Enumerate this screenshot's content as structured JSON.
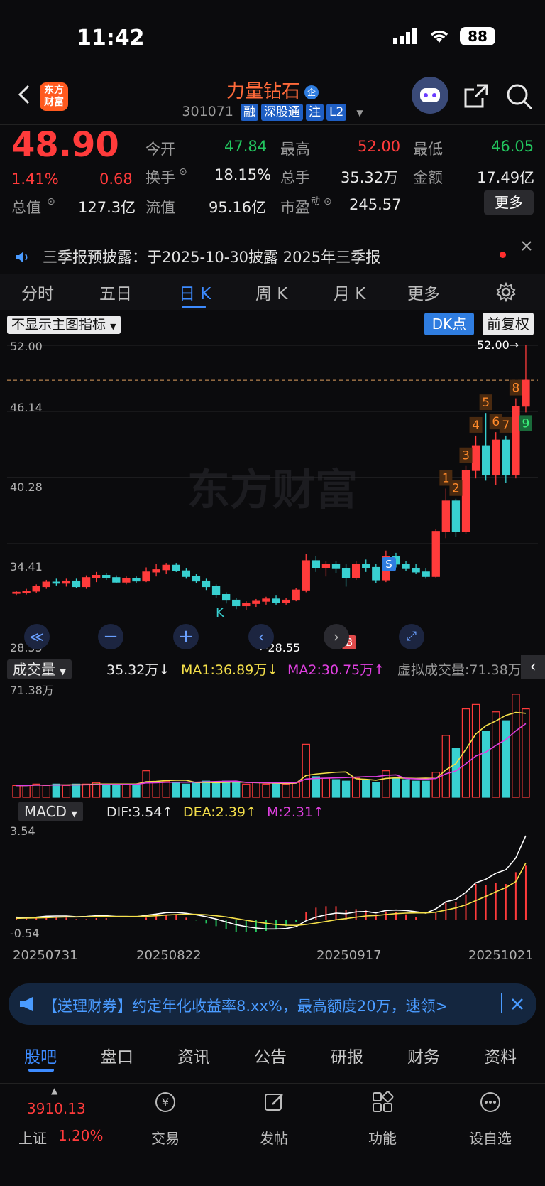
{
  "status_bar": {
    "time": "11:42",
    "battery": "88"
  },
  "header": {
    "logo_line1": "东方",
    "logo_line2": "财富",
    "stock_name": "力量钻石",
    "stock_badge": "企",
    "stock_code": "301071",
    "tags": [
      "融",
      "深股通",
      "注",
      "L2"
    ]
  },
  "quote": {
    "price": "48.90",
    "change_pct": "1.41%",
    "change": "0.68",
    "open_label": "今开",
    "open": "47.84",
    "high_label": "最高",
    "high": "52.00",
    "low_label": "最低",
    "low": "46.05",
    "turnover_label": "换手",
    "turnover": "18.15%",
    "volume_label": "总手",
    "volume": "35.32万",
    "amount_label": "金额",
    "amount": "17.49亿",
    "mcap_label": "总值",
    "mcap": "127.3亿",
    "float_label": "流值",
    "float_cap": "95.16亿",
    "pe_label": "市盈",
    "pe_super": "动",
    "pe": "245.57",
    "more_label": "更多"
  },
  "notice": {
    "text": "三季报预披露：于2025-10-30披露 2025年三季报"
  },
  "tabs": [
    {
      "label": "分时"
    },
    {
      "label": "五日"
    },
    {
      "label": "日 K"
    },
    {
      "label": "周 K"
    },
    {
      "label": "月 K"
    },
    {
      "label": "更多"
    }
  ],
  "chart_controls": {
    "indicator_dropdown": "不显示主图指标",
    "dk_label": "DK点",
    "fq_label": "前复权"
  },
  "price_axis": [
    "52.00",
    "46.14",
    "40.28",
    "34.41",
    "28.55"
  ],
  "chart_labels": {
    "high_marker": "52.00→",
    "low_marker": "←28.55",
    "k_marker": "K",
    "s_marker": "S",
    "b_marker": "B",
    "watermark": "东方财富",
    "nine_turn": [
      "1",
      "2",
      "3",
      "4",
      "5",
      "6",
      "7",
      "8",
      "9"
    ]
  },
  "volume_panel": {
    "dropdown": "成交量",
    "vol": "35.32万↓",
    "ma1": "MA1:36.89万↓",
    "ma2": "MA2:30.75万↑",
    "virtual": "虚拟成交量:71.38万",
    "max_label": "71.38万"
  },
  "macd_panel": {
    "dropdown": "MACD",
    "dif": "DIF:3.54↑",
    "dea": "DEA:2.39↑",
    "m": "M:2.31↑",
    "top_label": "3.54",
    "bottom_label": "-0.54"
  },
  "dates": [
    "20250731",
    "20250822",
    "20250917",
    "20251021"
  ],
  "banner": {
    "text": "【送理财券】约定年化收益率8.xx%，最高额度20万，速领>"
  },
  "bottom_tabs": [
    {
      "label": "股吧"
    },
    {
      "label": "盘口"
    },
    {
      "label": "资讯"
    },
    {
      "label": "公告"
    },
    {
      "label": "研报"
    },
    {
      "label": "财务"
    },
    {
      "label": "资料"
    }
  ],
  "bottom_nav": {
    "index_value": "3910.13",
    "index_name": "上证",
    "index_change": "1.20%",
    "items": [
      {
        "label": "交易"
      },
      {
        "label": "发帖"
      },
      {
        "label": "功能"
      },
      {
        "label": "设自选"
      }
    ]
  },
  "chart_data": {
    "type": "candlestick",
    "price_range": [
      28.55,
      52.0
    ],
    "candles": [
      [
        30.0,
        30.2,
        29.8,
        30.1
      ],
      [
        30.1,
        30.4,
        29.9,
        30.2
      ],
      [
        30.2,
        30.8,
        30.0,
        30.6
      ],
      [
        30.6,
        31.2,
        30.4,
        31.0
      ],
      [
        31.0,
        31.3,
        30.7,
        30.9
      ],
      [
        30.9,
        31.3,
        30.6,
        31.1
      ],
      [
        31.1,
        31.3,
        30.5,
        30.6
      ],
      [
        30.6,
        31.6,
        30.4,
        31.4
      ],
      [
        31.4,
        31.9,
        31.0,
        31.6
      ],
      [
        31.6,
        31.8,
        31.2,
        31.4
      ],
      [
        31.4,
        31.6,
        30.9,
        31.0
      ],
      [
        31.0,
        31.5,
        30.8,
        31.3
      ],
      [
        31.3,
        31.5,
        30.9,
        31.1
      ],
      [
        31.1,
        32.3,
        31.0,
        31.9
      ],
      [
        31.9,
        32.6,
        31.5,
        32.1
      ],
      [
        32.1,
        32.7,
        31.7,
        32.5
      ],
      [
        32.5,
        32.7,
        31.9,
        32.0
      ],
      [
        32.0,
        32.2,
        31.3,
        31.5
      ],
      [
        31.5,
        31.7,
        30.9,
        31.1
      ],
      [
        31.1,
        31.3,
        30.3,
        30.6
      ],
      [
        30.6,
        30.8,
        29.6,
        29.9
      ],
      [
        29.9,
        30.1,
        29.1,
        29.4
      ],
      [
        29.4,
        29.6,
        28.6,
        28.9
      ],
      [
        28.9,
        29.3,
        28.55,
        29.1
      ],
      [
        29.1,
        29.5,
        28.8,
        29.3
      ],
      [
        29.3,
        29.7,
        29.0,
        29.5
      ],
      [
        29.5,
        29.8,
        29.0,
        29.2
      ],
      [
        29.2,
        29.6,
        29.0,
        29.4
      ],
      [
        29.4,
        30.5,
        29.3,
        30.3
      ],
      [
        30.3,
        33.5,
        30.1,
        32.9
      ],
      [
        32.9,
        33.3,
        31.9,
        32.3
      ],
      [
        32.3,
        32.9,
        31.5,
        32.6
      ],
      [
        32.6,
        32.9,
        31.8,
        32.2
      ],
      [
        32.2,
        32.6,
        30.6,
        31.4
      ],
      [
        31.4,
        32.9,
        31.2,
        32.6
      ],
      [
        32.6,
        33.0,
        31.9,
        32.3
      ],
      [
        32.3,
        32.6,
        30.9,
        31.2
      ],
      [
        31.2,
        33.8,
        31.0,
        33.3
      ],
      [
        33.3,
        33.6,
        32.3,
        32.6
      ],
      [
        32.6,
        32.9,
        32.0,
        32.2
      ],
      [
        32.2,
        32.6,
        31.7,
        31.9
      ],
      [
        31.9,
        32.2,
        31.3,
        31.5
      ],
      [
        31.5,
        35.7,
        31.4,
        35.5
      ],
      [
        35.5,
        39.3,
        34.9,
        38.2
      ],
      [
        38.2,
        38.4,
        35.0,
        35.5
      ],
      [
        35.5,
        41.3,
        35.3,
        40.9
      ],
      [
        40.9,
        44.0,
        40.2,
        43.1
      ],
      [
        43.1,
        46.0,
        40.0,
        40.5
      ],
      [
        40.5,
        44.3,
        39.6,
        43.6
      ],
      [
        43.6,
        44.0,
        39.8,
        40.5
      ],
      [
        40.5,
        47.3,
        40.2,
        46.6
      ],
      [
        46.6,
        52.0,
        46.05,
        48.9
      ]
    ],
    "ma_volume_note": "volume in 万",
    "volumes": [
      8,
      8,
      9,
      8,
      9,
      8,
      9,
      9,
      10,
      9,
      8,
      9,
      9,
      18,
      10,
      11,
      10,
      9,
      10,
      11,
      10,
      11,
      10,
      9,
      10,
      9,
      10,
      9,
      10,
      36,
      14,
      13,
      12,
      11,
      13,
      12,
      10,
      18,
      13,
      12,
      11,
      11,
      17,
      42,
      33,
      60,
      63,
      45,
      58,
      52,
      70,
      60
    ],
    "macd": {
      "dif_end": 3.54,
      "dea_end": 2.39,
      "m_end": 2.31,
      "range": [
        -0.54,
        3.54
      ],
      "dif": [
        0.1,
        0.08,
        0.1,
        0.14,
        0.15,
        0.15,
        0.12,
        0.13,
        0.16,
        0.16,
        0.13,
        0.13,
        0.12,
        0.18,
        0.23,
        0.29,
        0.3,
        0.26,
        0.2,
        0.12,
        0.02,
        -0.1,
        -0.22,
        -0.3,
        -0.36,
        -0.4,
        -0.4,
        -0.38,
        -0.3,
        -0.05,
        0.1,
        0.2,
        0.27,
        0.25,
        0.32,
        0.34,
        0.28,
        0.38,
        0.4,
        0.38,
        0.33,
        0.27,
        0.45,
        0.75,
        0.85,
        1.15,
        1.55,
        1.7,
        1.95,
        2.1,
        2.6,
        3.54
      ],
      "dea": [
        0.05,
        0.06,
        0.07,
        0.08,
        0.1,
        0.11,
        0.11,
        0.12,
        0.13,
        0.13,
        0.13,
        0.13,
        0.13,
        0.14,
        0.16,
        0.19,
        0.21,
        0.22,
        0.22,
        0.2,
        0.16,
        0.11,
        0.04,
        -0.03,
        -0.1,
        -0.16,
        -0.21,
        -0.24,
        -0.25,
        -0.21,
        -0.15,
        -0.08,
        -0.01,
        0.04,
        0.1,
        0.15,
        0.17,
        0.21,
        0.25,
        0.27,
        0.28,
        0.28,
        0.31,
        0.4,
        0.49,
        0.62,
        0.8,
        0.98,
        1.17,
        1.35,
        1.6,
        2.39
      ]
    }
  }
}
